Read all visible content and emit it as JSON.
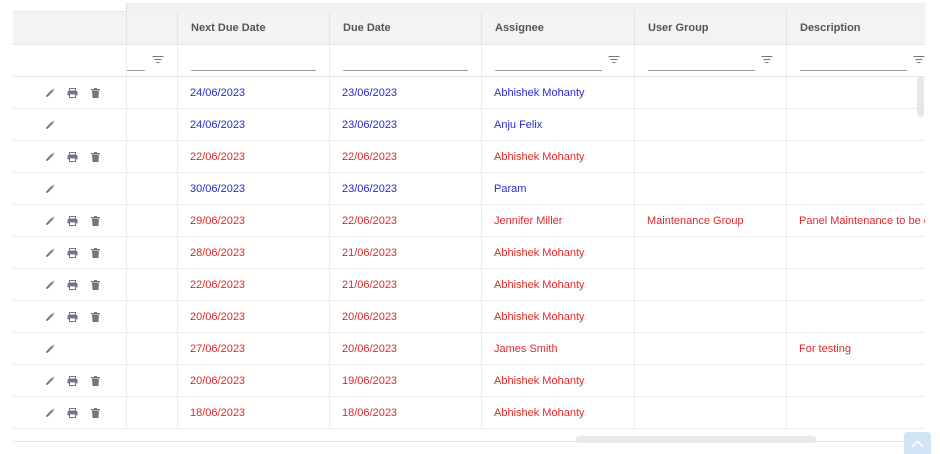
{
  "columns": {
    "next_due_date": "Next Due Date",
    "due_date": "Due Date",
    "assignee": "Assignee",
    "user_group": "User Group",
    "description": "Description"
  },
  "filters": {
    "next_due_date": "",
    "due_date": "",
    "assignee": "",
    "user_group": "",
    "description": ""
  },
  "row_actions": [
    "edit-icon",
    "print-icon",
    "delete-icon"
  ],
  "colors": {
    "overdue": "#e02a2a",
    "upcoming": "#2a2ad6"
  },
  "rows": [
    {
      "status": "blue",
      "actions": "full",
      "next_due_date": "24/06/2023",
      "due_date": "23/06/2023",
      "assignee": "Abhishek Mohanty",
      "user_group": "",
      "description": ""
    },
    {
      "status": "blue",
      "actions": "edit",
      "next_due_date": "24/06/2023",
      "due_date": "23/06/2023",
      "assignee": "Anju Felix",
      "user_group": "",
      "description": ""
    },
    {
      "status": "red",
      "actions": "full",
      "next_due_date": "22/06/2023",
      "due_date": "22/06/2023",
      "assignee": "Abhishek Mohanty",
      "user_group": "",
      "description": ""
    },
    {
      "status": "blue",
      "actions": "edit",
      "next_due_date": "30/06/2023",
      "due_date": "23/06/2023",
      "assignee": "Param",
      "user_group": "",
      "description": ""
    },
    {
      "status": "red",
      "actions": "full",
      "next_due_date": "29/06/2023",
      "due_date": "22/06/2023",
      "assignee": "Jennifer Miller",
      "user_group": "Maintenance Group",
      "description": "Panel Maintenance to be d"
    },
    {
      "status": "red",
      "actions": "full",
      "next_due_date": "28/06/2023",
      "due_date": "21/06/2023",
      "assignee": "Abhishek Mohanty",
      "user_group": "",
      "description": ""
    },
    {
      "status": "red",
      "actions": "full",
      "next_due_date": "22/06/2023",
      "due_date": "21/06/2023",
      "assignee": "Abhishek Mohanty",
      "user_group": "",
      "description": ""
    },
    {
      "status": "red",
      "actions": "full",
      "next_due_date": "20/06/2023",
      "due_date": "20/06/2023",
      "assignee": "Abhishek Mohanty",
      "user_group": "",
      "description": ""
    },
    {
      "status": "red",
      "actions": "edit",
      "next_due_date": "27/06/2023",
      "due_date": "20/06/2023",
      "assignee": "James Smith",
      "user_group": "",
      "description": "For testing"
    },
    {
      "status": "red",
      "actions": "full",
      "next_due_date": "20/06/2023",
      "due_date": "19/06/2023",
      "assignee": "Abhishek Mohanty",
      "user_group": "",
      "description": ""
    },
    {
      "status": "red",
      "actions": "full",
      "next_due_date": "18/06/2023",
      "due_date": "18/06/2023",
      "assignee": "Abhishek Mohanty",
      "user_group": "",
      "description": ""
    }
  ]
}
